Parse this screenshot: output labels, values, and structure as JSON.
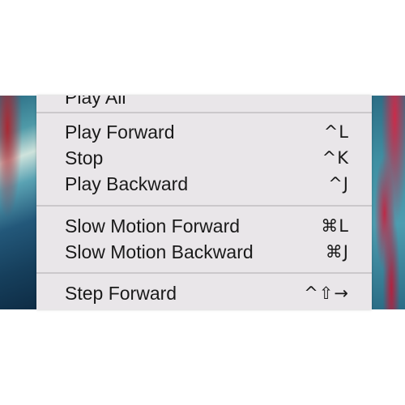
{
  "menu": {
    "partial_item_label": "Play All",
    "groups": [
      [
        {
          "label": "Play Forward",
          "shortcut": "^L"
        },
        {
          "label": "Stop",
          "shortcut": "^K"
        },
        {
          "label": "Play Backward",
          "shortcut": "^J"
        }
      ],
      [
        {
          "label": "Slow Motion Forward",
          "shortcut": "⌘L"
        },
        {
          "label": "Slow Motion Backward",
          "shortcut": "⌘J"
        }
      ],
      [
        {
          "label": "Step Forward",
          "shortcut": "^⇧→"
        }
      ]
    ]
  },
  "colors": {
    "menu_background": "#e9e6e9",
    "text": "#1a1a1a",
    "separator": "#cbc8cb"
  }
}
